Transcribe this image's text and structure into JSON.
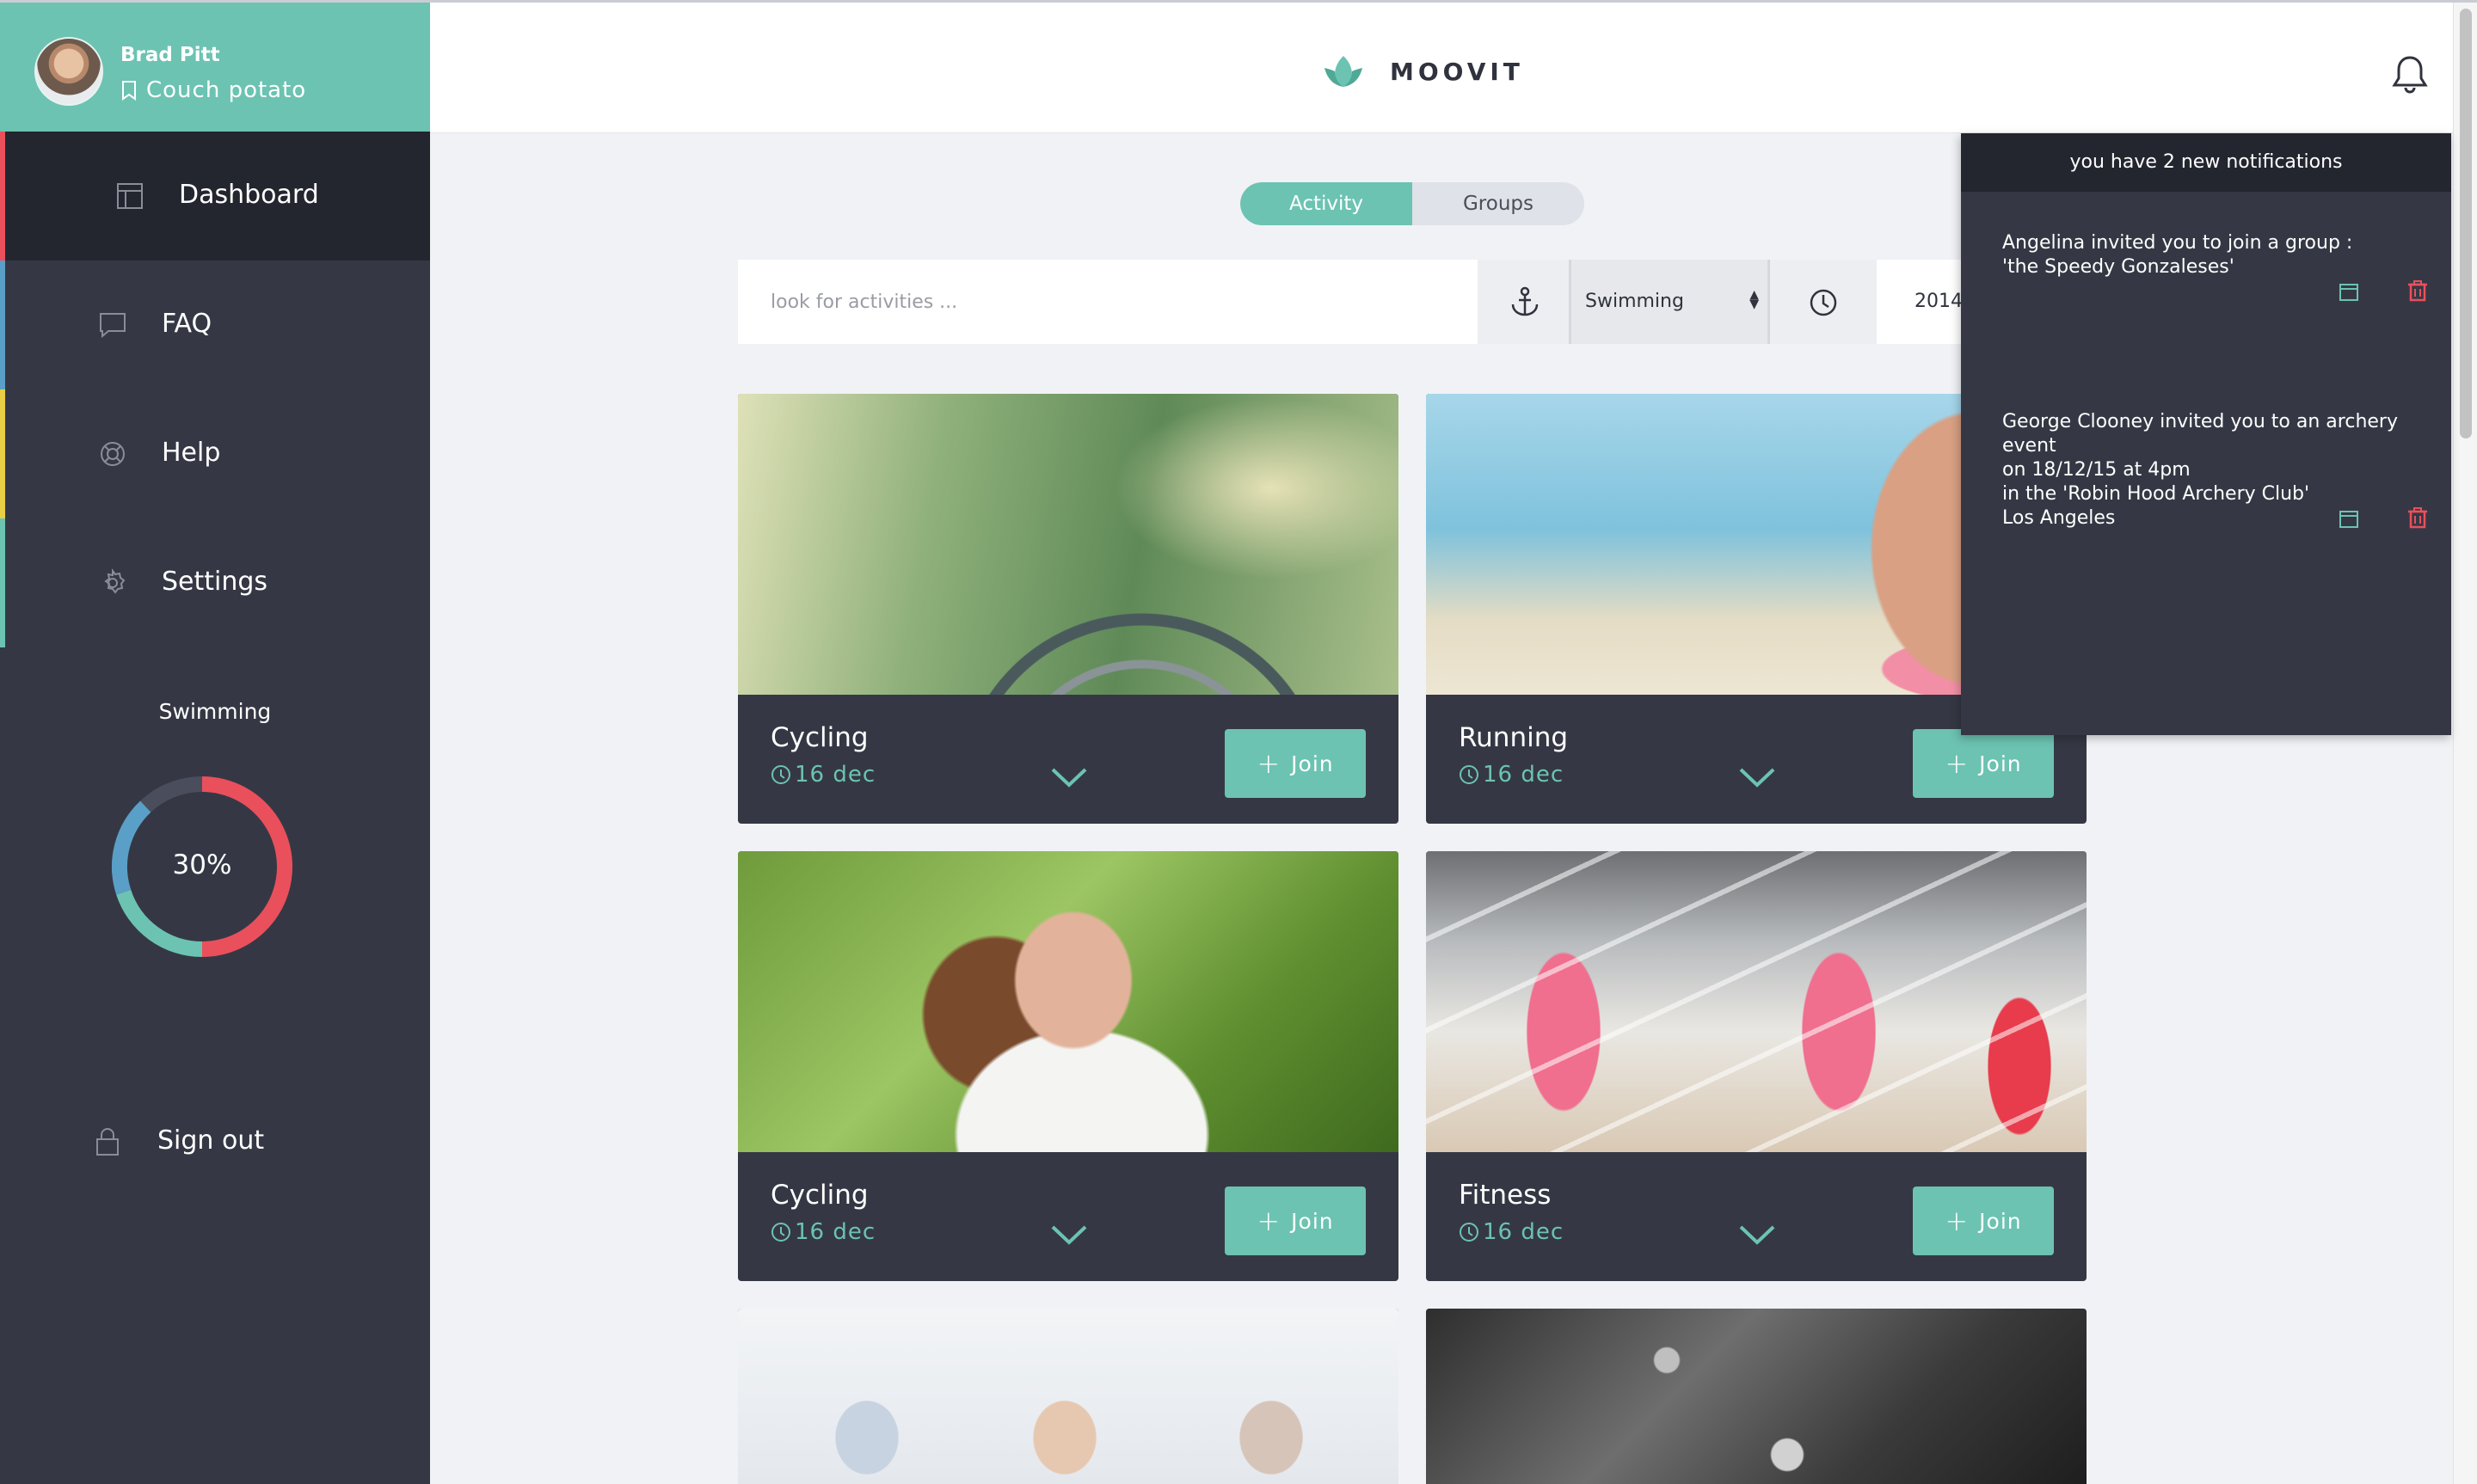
{
  "user": {
    "name": "Brad Pitt",
    "status": "Couch potato"
  },
  "nav": [
    {
      "label": "Dashboard",
      "icon": "dashboard-icon",
      "accent": "#e9505c"
    },
    {
      "label": "FAQ",
      "icon": "chat-bubble-icon",
      "accent": "#5a9fc7"
    },
    {
      "label": "Help",
      "icon": "lifebuoy-icon",
      "accent": "#e8cf45"
    },
    {
      "label": "Settings",
      "icon": "gear-icon",
      "accent": "#6cc3b2"
    }
  ],
  "stats": {
    "title": "Swimming",
    "value": "30%",
    "segments": [
      {
        "name": "red",
        "fraction": 0.5,
        "color": "#e9505c"
      },
      {
        "name": "teal",
        "fraction": 0.2,
        "color": "#6cc3b2"
      },
      {
        "name": "blue",
        "fraction": 0.18,
        "color": "#5a9fc7"
      },
      {
        "name": "dark",
        "fraction": 0.12,
        "color": "#4a4e5c"
      }
    ]
  },
  "signout": {
    "label": "Sign out"
  },
  "header": {
    "brand": "MOOVIT"
  },
  "tabs": {
    "activity": "Activity",
    "groups": "Groups"
  },
  "search": {
    "placeholder": "look for activities ...",
    "sport": "Swimming",
    "date": "2014"
  },
  "cards": [
    {
      "title": "Cycling",
      "date": "16 dec",
      "join": "Join"
    },
    {
      "title": "Running",
      "date": "16 dec",
      "join": "Join"
    },
    {
      "title": "Cycling",
      "date": "16 dec",
      "join": "Join"
    },
    {
      "title": "Fitness",
      "date": "16 dec",
      "join": "Join"
    }
  ],
  "notifications": {
    "header": "you have 2 new notifications",
    "items": [
      {
        "lines": [
          "Angelina invited you to join a group :",
          "'the Speedy Gonzaleses'"
        ]
      },
      {
        "lines": [
          "George Clooney invited you to an archery event",
          "on 18/12/15 at 4pm",
          "in the 'Robin Hood Archery Club'",
          "Los Angeles"
        ]
      }
    ]
  },
  "colors": {
    "accent": "#6cc3b2",
    "sidebar": "#353844",
    "danger": "#e9505c"
  }
}
